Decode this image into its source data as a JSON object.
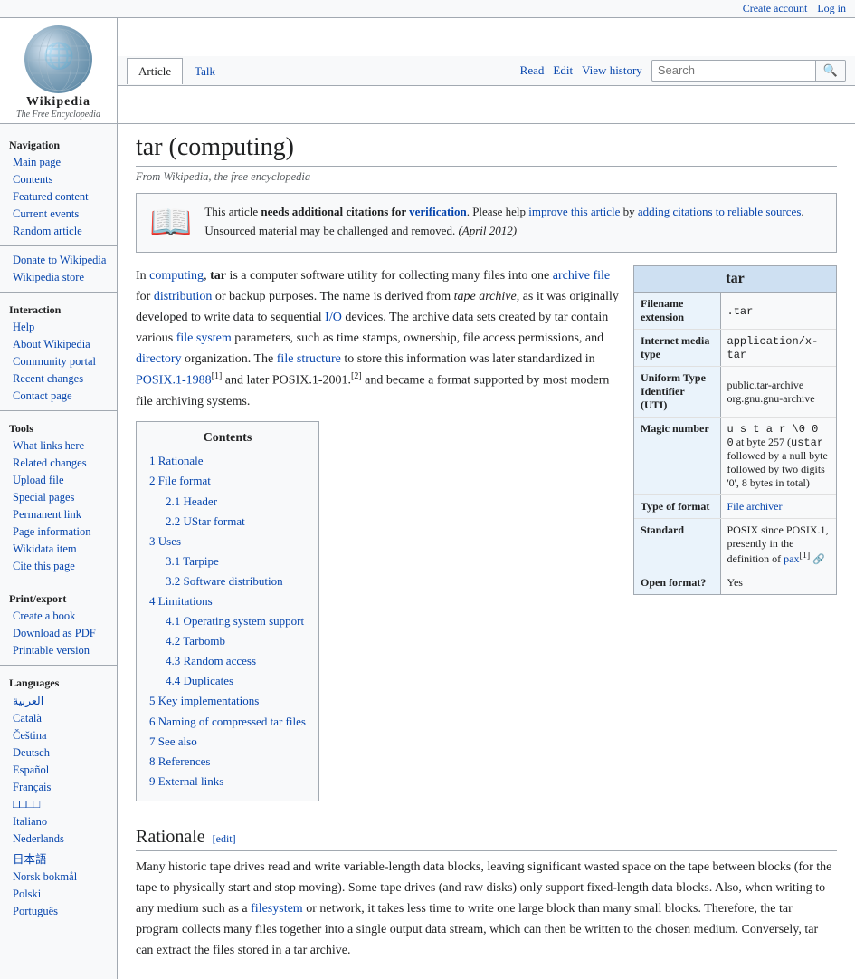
{
  "topbar": {
    "create_account": "Create account",
    "log_in": "Log in"
  },
  "logo": {
    "wordmark": "Wikipedia",
    "tagline": "The Free Encyclopedia",
    "globe_text": "🌐"
  },
  "tabs": {
    "article": "Article",
    "talk": "Talk",
    "read": "Read",
    "edit": "Edit",
    "view_history": "View history"
  },
  "search": {
    "placeholder": "Search",
    "button_label": "🔍"
  },
  "sidebar": {
    "navigation_title": "Navigation",
    "nav_items": [
      "Main page",
      "Contents",
      "Featured content",
      "Current events",
      "Random article"
    ],
    "donate": "Donate to Wikipedia",
    "store": "Wikipedia store",
    "interaction_title": "Interaction",
    "interaction_items": [
      "Help",
      "About Wikipedia",
      "Community portal",
      "Recent changes",
      "Contact page"
    ],
    "tools_title": "Tools",
    "tools_items": [
      "What links here",
      "Related changes",
      "Upload file",
      "Special pages",
      "Permanent link",
      "Page information",
      "Wikidata item",
      "Cite this page"
    ],
    "print_title": "Print/export",
    "print_items": [
      "Create a book",
      "Download as PDF",
      "Printable version"
    ],
    "languages_title": "Languages",
    "languages": [
      "العربية",
      "Català",
      "Čeština",
      "Deutsch",
      "Español",
      "Français",
      "□□□□",
      "Italiano",
      "Nederlands",
      "日本語",
      "Norsk bokmål",
      "Polski",
      "Português"
    ]
  },
  "page": {
    "title": "tar (computing)",
    "subtitle": "From Wikipedia, the free encyclopedia"
  },
  "notice": {
    "icon": "📖",
    "text_html": "This article <b>needs additional citations for <a href='#'>verification</a></b>. Please help <a href='#'>improve this article</a> by <a href='#'>adding citations to reliable sources</a>. Unsourced material may be challenged and removed. <i>(April 2012)</i>"
  },
  "intro": {
    "paragraph": "In computing, tar is a computer software utility for collecting many files into one archive file for distribution or backup purposes. The name is derived from tape archive, as it was originally developed to write data to sequential I/O devices. The archive data sets created by tar contain various file system parameters, such as time stamps, ownership, file access permissions, and directory organization. The file structure to store this information was later standardized in POSIX.1-1988[1] and later POSIX.1-2001.[2] and became a format supported by most modern file archiving systems."
  },
  "infobox": {
    "title": "tar",
    "rows": [
      {
        "label": "Filename extension",
        "value": ".tar"
      },
      {
        "label": "Internet media type",
        "value": "application/x-tar"
      },
      {
        "label": "Uniform Type Identifier (UTI)",
        "value": "public.tar-archive\norg.gnu.gnu-archive"
      },
      {
        "label": "Magic number",
        "value": "u s t a r \\0 0 0 at byte 257 (ustar followed by a null byte followed by two digits '0', 8 bytes in total)"
      },
      {
        "label": "Type of format",
        "value": "File archiver"
      },
      {
        "label": "Standard",
        "value": "POSIX since POSIX.1, presently in the definition of pax[1]"
      },
      {
        "label": "Open format?",
        "value": "Yes"
      }
    ]
  },
  "toc": {
    "title": "Contents",
    "items": [
      {
        "num": "1",
        "label": "Rationale",
        "sub": []
      },
      {
        "num": "2",
        "label": "File format",
        "sub": [
          {
            "num": "2.1",
            "label": "Header"
          },
          {
            "num": "2.2",
            "label": "UStar format"
          }
        ]
      },
      {
        "num": "3",
        "label": "Uses",
        "sub": [
          {
            "num": "3.1",
            "label": "Tarpipe"
          },
          {
            "num": "3.2",
            "label": "Software distribution"
          }
        ]
      },
      {
        "num": "4",
        "label": "Limitations",
        "sub": [
          {
            "num": "4.1",
            "label": "Operating system support"
          },
          {
            "num": "4.2",
            "label": "Tarbomb"
          },
          {
            "num": "4.3",
            "label": "Random access"
          },
          {
            "num": "4.4",
            "label": "Duplicates"
          }
        ]
      },
      {
        "num": "5",
        "label": "Key implementations",
        "sub": []
      },
      {
        "num": "6",
        "label": "Naming of compressed tar files",
        "sub": []
      },
      {
        "num": "7",
        "label": "See also",
        "sub": []
      },
      {
        "num": "8",
        "label": "References",
        "sub": []
      },
      {
        "num": "9",
        "label": "External links",
        "sub": []
      }
    ]
  },
  "rationale": {
    "heading": "Rationale",
    "edit_label": "[edit]",
    "paragraph1": "Many historic tape drives read and write variable-length data blocks, leaving significant wasted space on the tape between blocks (for the tape to physically start and stop moving). Some tape drives (and raw disks) only support fixed-length data blocks. Also, when writing to any medium such as a filesystem or network, it takes less time to write one large block than many small blocks. Therefore, the tar program collects many files together into a single output data stream, which can then be written to the chosen medium. Conversely, tar can extract the files stored in a tar archive."
  }
}
